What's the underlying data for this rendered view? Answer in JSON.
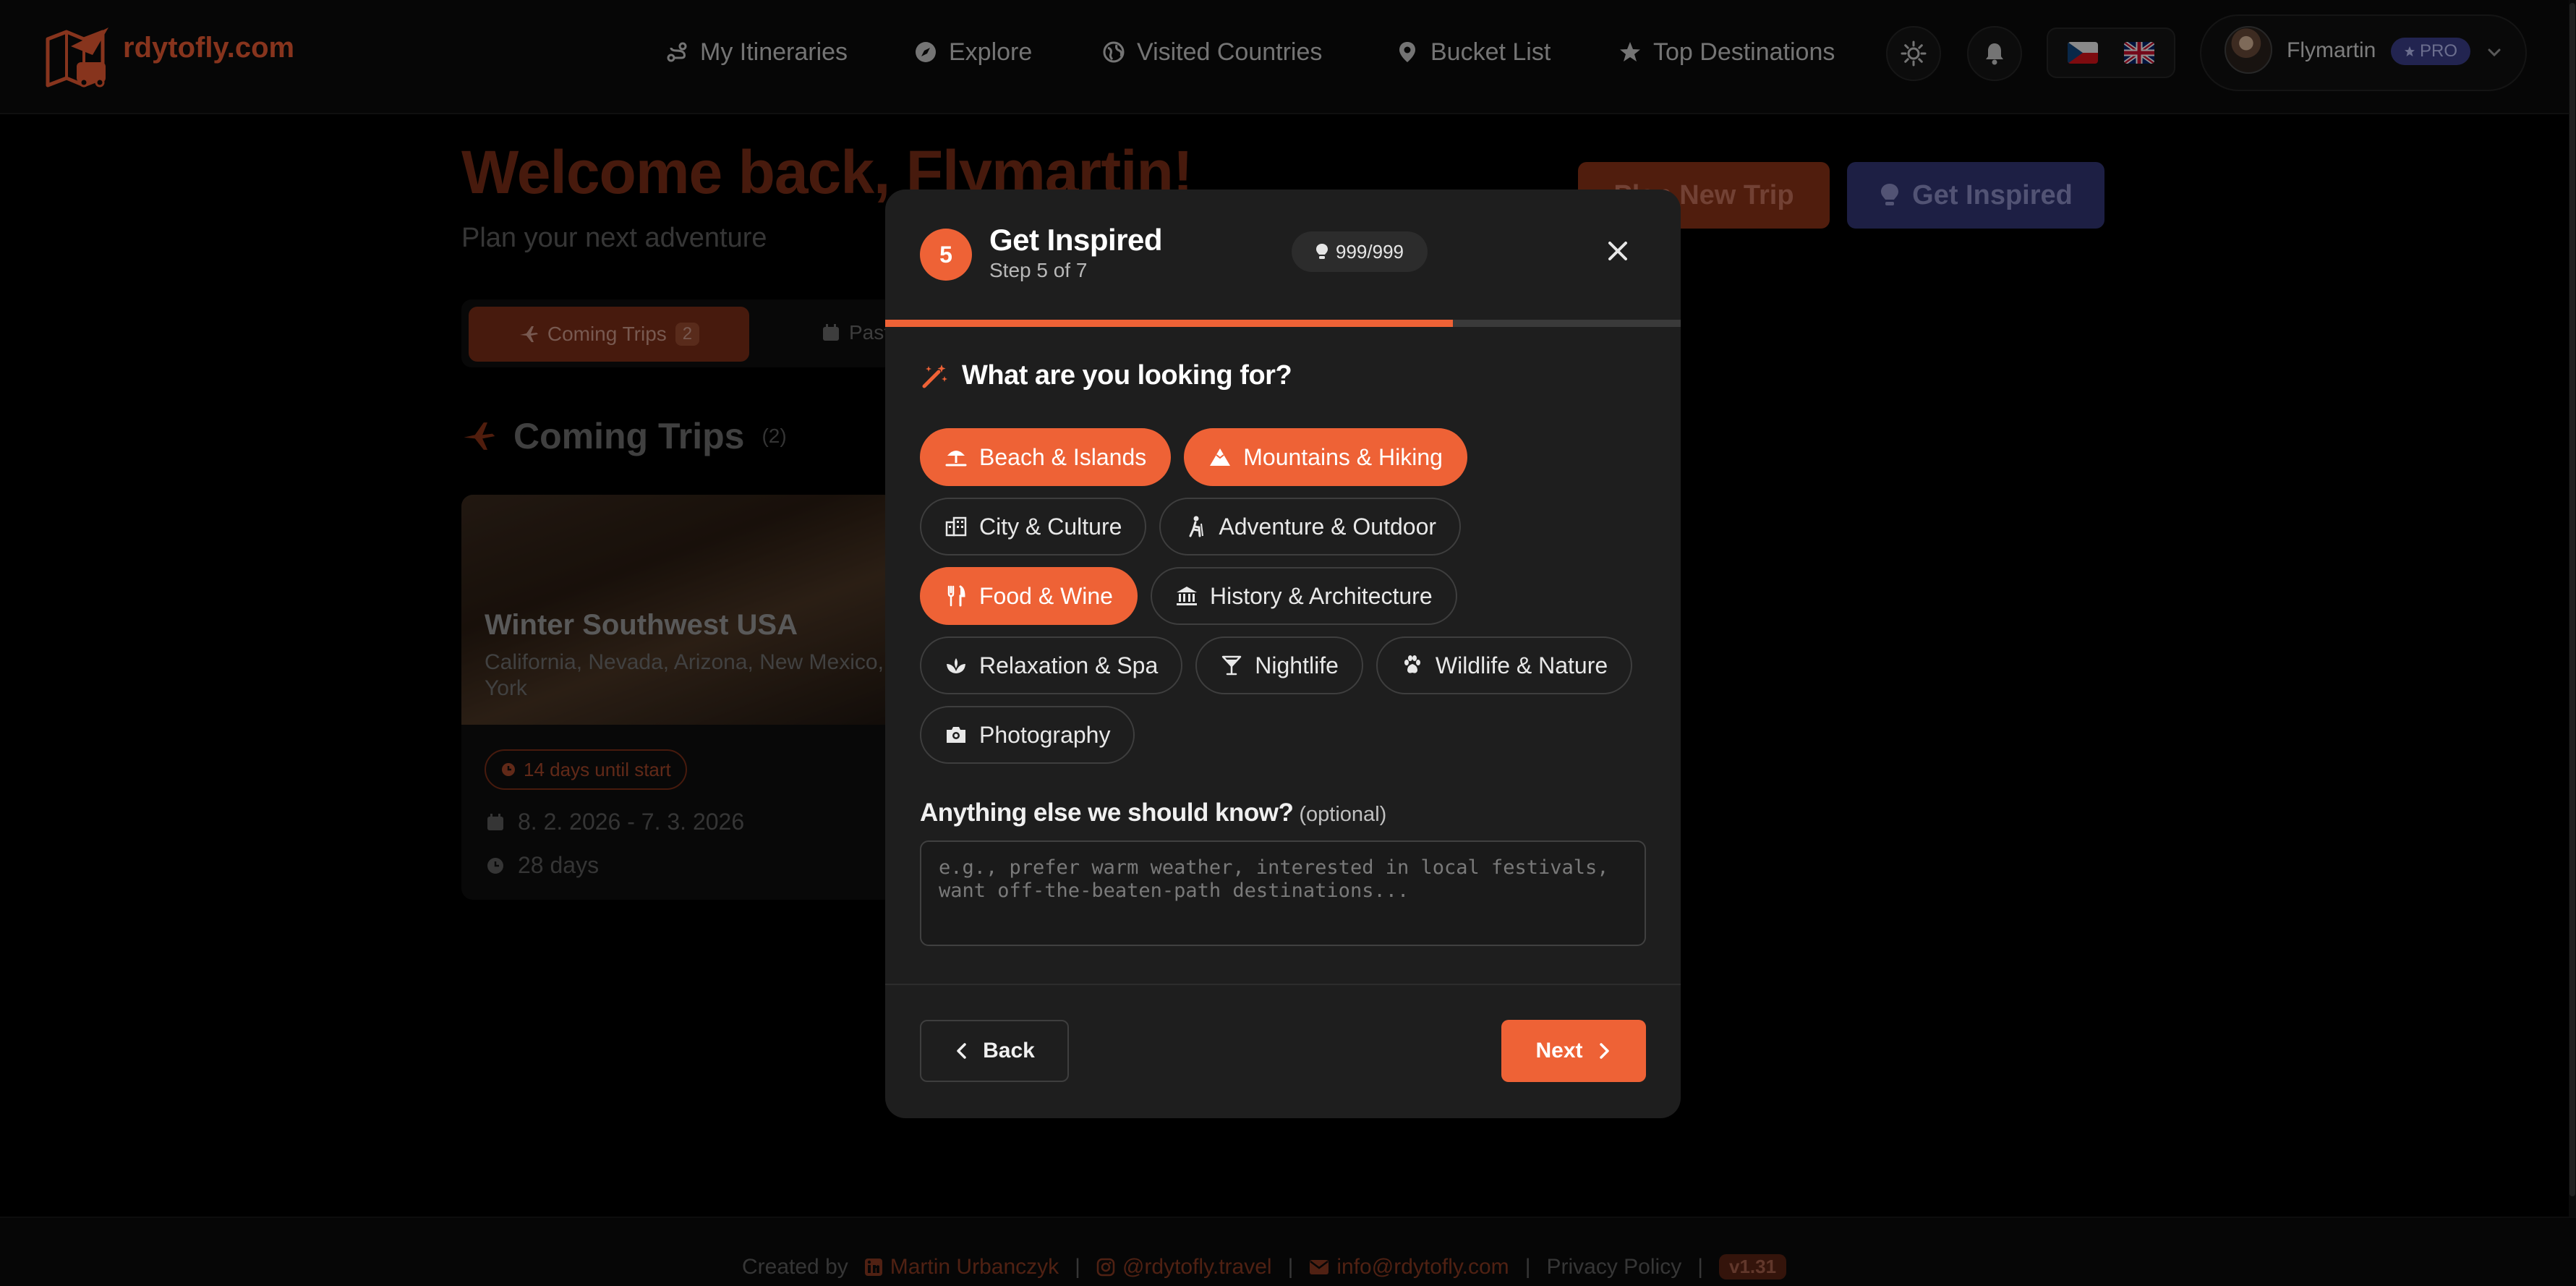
{
  "brand": {
    "name": "rdytofly.com",
    "accent": "#ee6236",
    "logo_icon": "plane-map-logo-icon"
  },
  "nav": {
    "items": [
      {
        "label": "My Itineraries",
        "icon": "route-icon"
      },
      {
        "label": "Explore",
        "icon": "compass-icon"
      },
      {
        "label": "Visited Countries",
        "icon": "globe-icon"
      },
      {
        "label": "Bucket List",
        "icon": "pin-icon"
      },
      {
        "label": "Top Destinations",
        "icon": "star-icon"
      }
    ],
    "theme_icon": "sun-icon",
    "notifications_icon": "bell-icon",
    "languages": [
      "cz-flag-icon",
      "uk-flag-icon"
    ]
  },
  "user": {
    "name": "Flymartin",
    "badge": "PRO"
  },
  "page": {
    "welcome": "Welcome back, Flymartin!",
    "subtitle": "Plan your next adventure",
    "plan_button": "Plan New Trip",
    "inspire_button": "Get Inspired",
    "tabs": {
      "coming_label": "Coming Trips",
      "coming_count": "2",
      "past_label": "Past"
    },
    "section_title": "Coming Trips",
    "section_count": "(2)"
  },
  "trip_card": {
    "title": "Winter Southwest USA",
    "regions": "California, Nevada, Arizona, New Mexico, York",
    "countdown": "14 days until start",
    "dates": "8. 2. 2026 - 7. 3. 2026",
    "duration": "28 days"
  },
  "modal": {
    "step_number": "5",
    "title": "Get Inspired",
    "step_text": "Step 5 of 7",
    "quota": "999/999",
    "progress": 0.714,
    "question": "What are you looking for?",
    "categories": [
      [
        {
          "label": "Beach & Islands",
          "icon": "umbrella-beach-icon",
          "selected": true
        },
        {
          "label": "Mountains & Hiking",
          "icon": "mountain-icon",
          "selected": true
        }
      ],
      [
        {
          "label": "City & Culture",
          "icon": "city-icon",
          "selected": false
        },
        {
          "label": "Adventure & Outdoor",
          "icon": "hiker-icon",
          "selected": false
        }
      ],
      [
        {
          "label": "Food & Wine",
          "icon": "utensils-icon",
          "selected": true
        },
        {
          "label": "History & Architecture",
          "icon": "landmark-icon",
          "selected": false
        }
      ],
      [
        {
          "label": "Relaxation & Spa",
          "icon": "spa-icon",
          "selected": false
        },
        {
          "label": "Nightlife",
          "icon": "cocktail-icon",
          "selected": false
        },
        {
          "label": "Wildlife & Nature",
          "icon": "paw-icon",
          "selected": false
        }
      ],
      [
        {
          "label": "Photography",
          "icon": "camera-icon",
          "selected": false
        }
      ]
    ],
    "notes_label": "Anything else we should know?",
    "notes_optional": "(optional)",
    "notes_placeholder": "e.g., prefer warm weather, interested in local festivals, want off-the-beaten-path destinations...",
    "notes_value": "",
    "back_label": "Back",
    "next_label": "Next"
  },
  "footer": {
    "created_by": "Created by",
    "author": "Martin Urbanczyk",
    "instagram": "@rdytofly.travel",
    "email": "info@rdytofly.com",
    "privacy": "Privacy Policy",
    "version": "v1.31",
    "separator": "|"
  }
}
